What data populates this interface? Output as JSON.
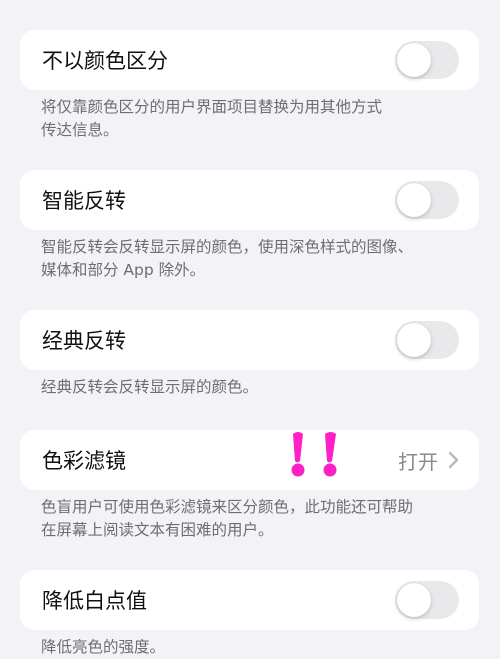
{
  "settings": [
    {
      "label": "不以颜色区分",
      "type": "toggle",
      "state": "off",
      "description": [
        "将仅靠颜色区分的用户界面项目替换为用其他方式",
        "传达信息。"
      ]
    },
    {
      "label": "智能反转",
      "type": "toggle",
      "state": "off",
      "description": [
        "智能反转会反转显示屏的颜色，使用深色样式的图像、",
        "媒体和部分 App 除外。"
      ]
    },
    {
      "label": "经典反转",
      "type": "toggle",
      "state": "off",
      "description": [
        "经典反转会反转显示屏的颜色。"
      ]
    },
    {
      "label": "色彩滤镜",
      "type": "link",
      "value": "打开",
      "description": [
        "色盲用户可使用色彩滤镜来区分颜色，此功能还可帮助",
        "在屏幕上阅读文本有困难的用户。"
      ]
    },
    {
      "label": "降低白点值",
      "type": "toggle",
      "state": "off",
      "description": [
        "降低亮色的强度。"
      ]
    }
  ],
  "colors": {
    "background": "#f2f2f7",
    "card": "#ffffff",
    "toggle_off": "#e9e9eb",
    "secondary_text": "#6d6d72",
    "annotation": "#ff1fc7"
  },
  "icons": {
    "chevron": "chevron-right-icon",
    "annotation": "double-exclamation-icon"
  }
}
